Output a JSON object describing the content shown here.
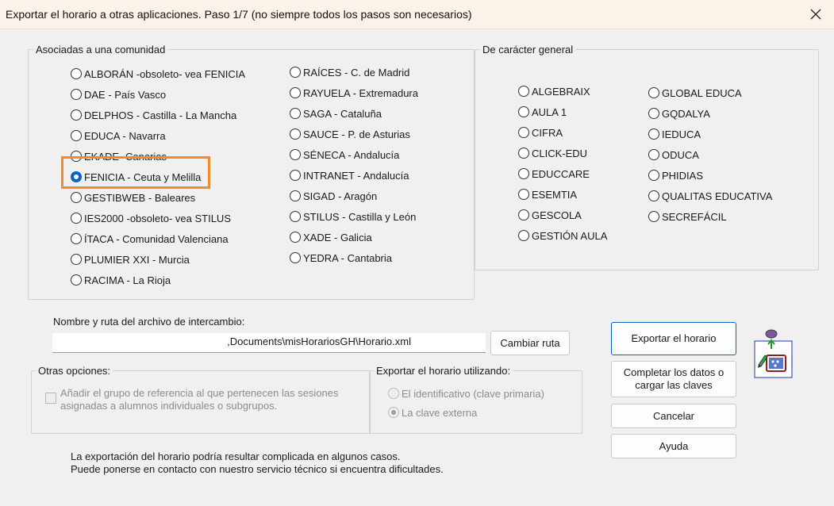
{
  "window": {
    "title": "Exportar el horario a otras aplicaciones.  Paso 1/7 (no siempre todos los pasos son necesarios)"
  },
  "community_group": {
    "label": "Asociadas a una comunidad",
    "col1": [
      {
        "label": "ALBORÁN -obsoleto- vea FENICIA",
        "checked": false
      },
      {
        "label": "DAE - País Vasco",
        "checked": false
      },
      {
        "label": "DELPHOS - Castilla - La Mancha",
        "checked": false
      },
      {
        "label": "EDUCA - Navarra",
        "checked": false
      },
      {
        "label": "EKADE- Canarias",
        "checked": false
      },
      {
        "label": "FENICIA - Ceuta y Melilla",
        "checked": true
      },
      {
        "label": "GESTIBWEB -  Baleares",
        "checked": false
      },
      {
        "label": "IES2000 -obsoleto- vea STILUS",
        "checked": false
      },
      {
        "label": "ÍTACA - Comunidad Valenciana",
        "checked": false
      },
      {
        "label": "PLUMIER XXI - Murcia",
        "checked": false
      },
      {
        "label": "RACIMA - La Rioja",
        "checked": false
      }
    ],
    "col2": [
      {
        "label": "RAÍCES - C. de Madrid",
        "checked": false
      },
      {
        "label": "RAYUELA - Extremadura",
        "checked": false
      },
      {
        "label": "SAGA - Cataluña",
        "checked": false
      },
      {
        "label": "SAUCE - P. de Asturias",
        "checked": false
      },
      {
        "label": "SÉNECA - Andalucía",
        "checked": false
      },
      {
        "label": "INTRANET - Andalucía",
        "checked": false
      },
      {
        "label": "SIGAD - Aragón",
        "checked": false
      },
      {
        "label": "STILUS - Castilla y León",
        "checked": false
      },
      {
        "label": "XADE - Galicia",
        "checked": false
      },
      {
        "label": "YEDRA - Cantabria",
        "checked": false
      }
    ]
  },
  "general_group": {
    "label": "De carácter general",
    "col1": [
      {
        "label": "ALGEBRAIX"
      },
      {
        "label": "AULA 1"
      },
      {
        "label": "CIFRA"
      },
      {
        "label": "CLICK-EDU"
      },
      {
        "label": "EDUCCARE"
      },
      {
        "label": "ESEMTIA"
      },
      {
        "label": "GESCOLA"
      },
      {
        "label": "GESTIÓN AULA"
      }
    ],
    "col2": [
      {
        "label": "GLOBAL EDUCA"
      },
      {
        "label": "GQDALYA"
      },
      {
        "label": "IEDUCA"
      },
      {
        "label": "ODUCA"
      },
      {
        "label": "PHIDIAS"
      },
      {
        "label": "QUALITAS EDUCATIVA"
      },
      {
        "label": "SECREFÁCIL"
      }
    ]
  },
  "exchange_file": {
    "label": "Nombre y ruta del archivo de intercambio:",
    "value": ",Documents\\misHorariosGH\\Horario.xml",
    "change_button": "Cambiar ruta"
  },
  "other_options": {
    "label": "Otras opciones:",
    "checkbox_line1": "Añadir el grupo de referencia al que pertenecen las sesiones",
    "checkbox_line2": "asignadas a alumnos individuales o subgrupos."
  },
  "export_using": {
    "label": "Exportar el horario utilizando:",
    "option1": "El identificativo (clave primaria)",
    "option2": "La clave externa"
  },
  "buttons": {
    "export": "Exportar el horario",
    "complete_line1": "Completar los datos o",
    "complete_line2": "cargar las claves",
    "cancel": "Cancelar",
    "help": "Ayuda"
  },
  "notes": {
    "line1": "La exportación del horario podría resultar complicada en algunos casos.",
    "line2": "Puede ponerse en contacto con nuestro servicio técnico si encuentra dificultades."
  },
  "colors": {
    "accent": "#0a62c9",
    "highlight": "#f08a2a"
  }
}
